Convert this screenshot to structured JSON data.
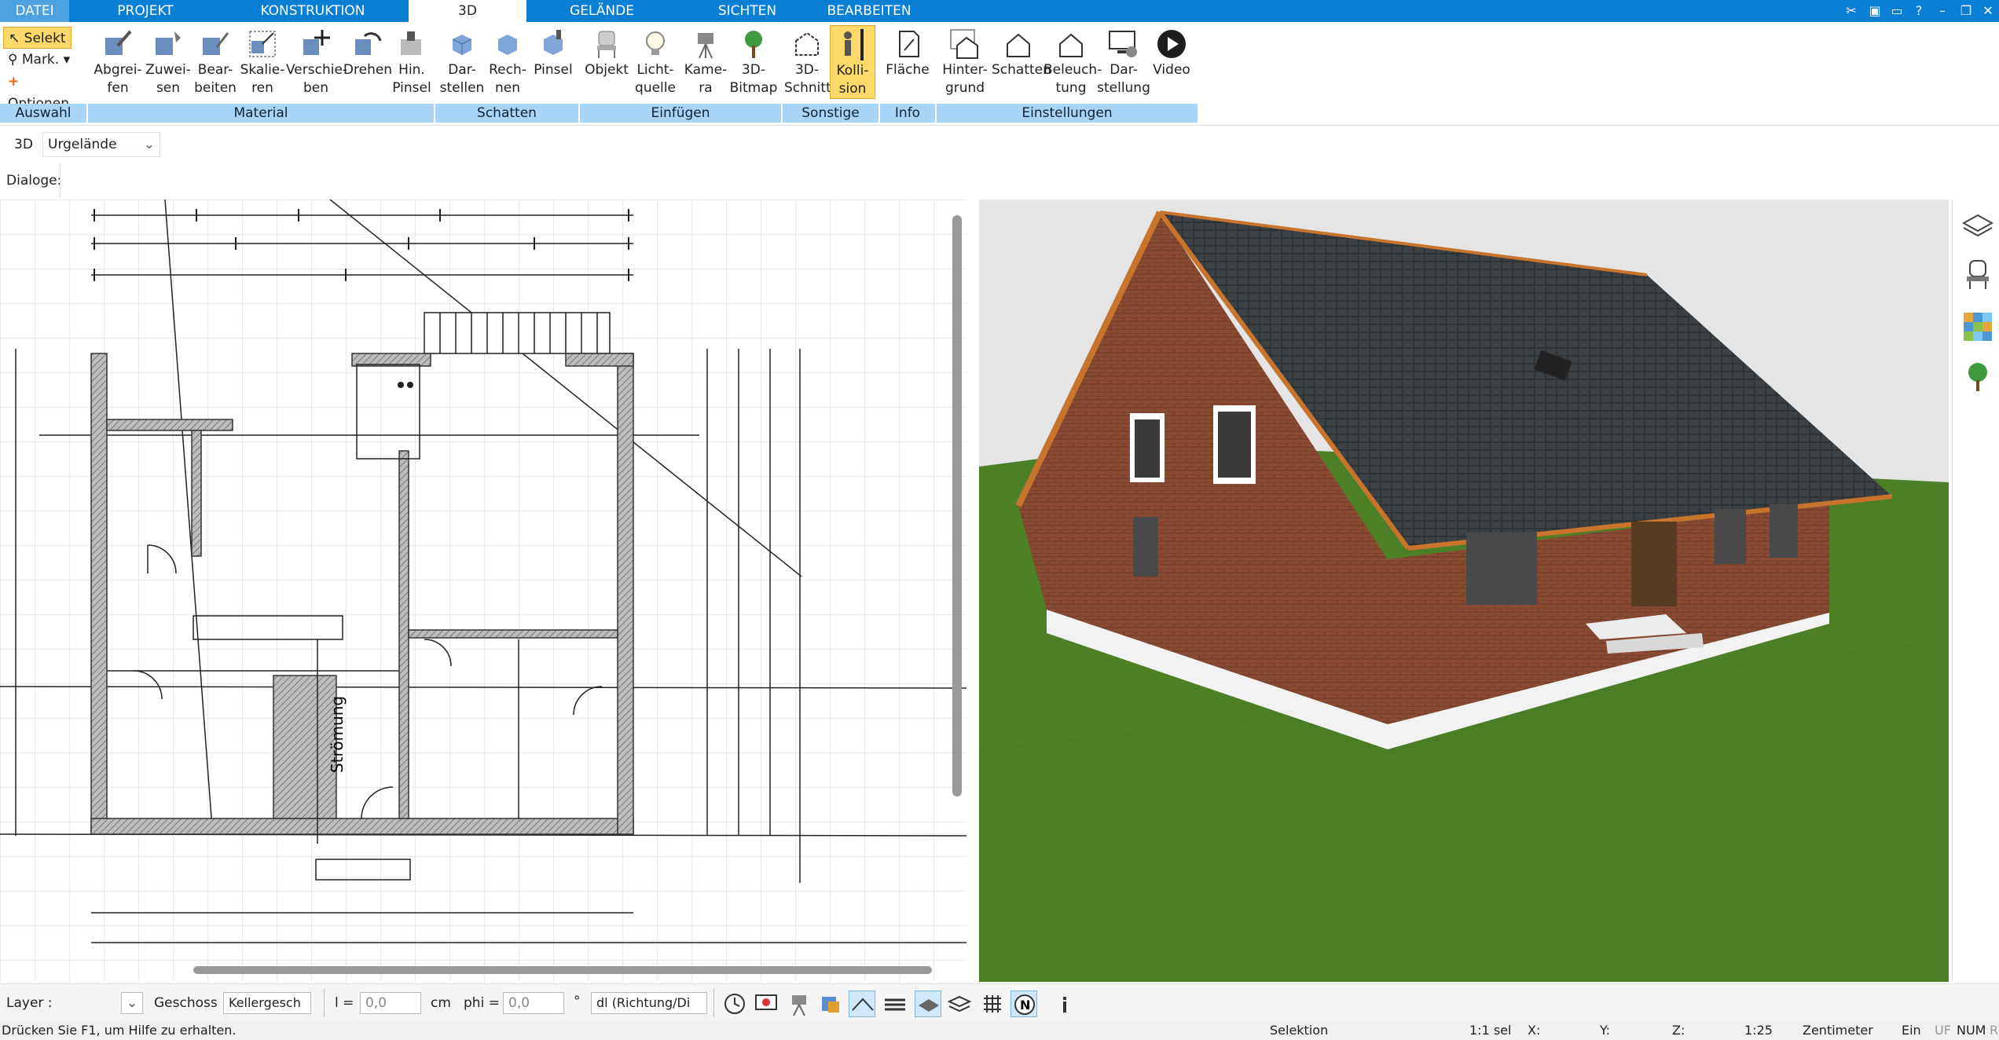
{
  "tabs": [
    "DATEI",
    "PROJEKT",
    "KONSTRUKTION",
    "3D",
    "GELÄNDE",
    "SICHTEN",
    "BEARBEITEN"
  ],
  "selection": {
    "selekt": "Selekt",
    "mark": "Mark.",
    "optionen": "Optionen",
    "group": "Auswahl"
  },
  "material": {
    "group": "Material",
    "abgreifen": "Abgrei-\nfen",
    "zuweisen": "Zuwei-\nsen",
    "bearbeiten": "Bear-\nbeiten",
    "skalieren": "Skalie-\nren",
    "verschieben": "Verschie-\nben",
    "drehen": "Drehen",
    "hinpinsel": "Hin.\nPinsel"
  },
  "schatten": {
    "group": "Schatten",
    "darstellen": "Dar-\nstellen",
    "rechnen": "Rech-\nnen",
    "pinsel": "Pinsel"
  },
  "einfuegen": {
    "group": "Einfügen",
    "objekt": "Objekt",
    "lichtquelle": "Licht-\nquelle",
    "kamera": "Kame-\nra",
    "bitmap": "3D-\nBitmap"
  },
  "sonstige": {
    "group": "Sonstige",
    "schnitt": "3D-\nSchnitt",
    "kollision": "Kolli-\nsion"
  },
  "info": {
    "group": "Info",
    "flaeche": "Fläche"
  },
  "einstellungen": {
    "group": "Einstellungen",
    "hintergrund": "Hinter-\ngrund",
    "schatten": "Schatten",
    "beleuchtung": "Beleuch-\ntung",
    "darstellung": "Dar-\nstellung",
    "video": "Video"
  },
  "filter": {
    "mode": "3D",
    "value": "Urgelände"
  },
  "dialoge_label": "Dialoge:",
  "plan_label": "Strömung",
  "bottom": {
    "layer_label": "Layer :",
    "geschoss_label": "Geschoss :",
    "geschoss_value": "Kellergesch",
    "l_label": "l =",
    "l_value": "0,0",
    "l_unit": "cm",
    "phi_label": "phi =",
    "phi_value": "0,0",
    "phi_unit": "°",
    "dl_value": "dl (Richtung/Di"
  },
  "status": {
    "help": "Drücken Sie F1, um Hilfe zu erhalten.",
    "mode": "Selektion",
    "sel": "1:1 sel",
    "x": "X:",
    "y": "Y:",
    "z": "Z:",
    "scale": "1:25",
    "unit": "Zentimeter",
    "ein": "Ein",
    "uf": "UF",
    "num": "NUM",
    "r": "R"
  },
  "colors": {
    "accent": "#0a7fd6",
    "grouplabel": "#a8d4f7",
    "brick": "#8a4b33",
    "roof": "#3c4145",
    "grass": "#4d7f27"
  }
}
